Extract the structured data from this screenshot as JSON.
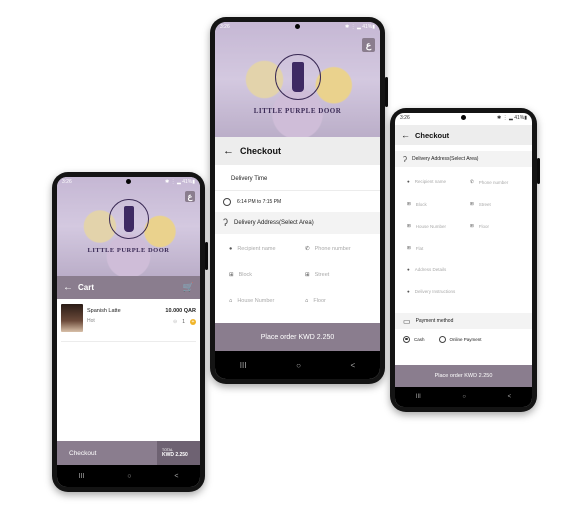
{
  "brand": {
    "logo_text": "LITTLE PURPLE DOOR",
    "accent": "#8a7d8e",
    "lang_button": "ع"
  },
  "cart_phone": {
    "status": {
      "time": "3:26",
      "right": "✱ ⋮ ▂ 41%▮"
    },
    "title": "Cart",
    "item": {
      "name": "Spanish Latte",
      "option": "Hot",
      "price": "10.000 QAR",
      "quantity": "1"
    },
    "footer": {
      "checkout_label": "Checkout",
      "total_label": "TOTAL",
      "total_value": "KWD 2.250"
    }
  },
  "checkout_phone": {
    "status": {
      "time": "3:26",
      "right": "✱ ⋮ ▂ 41%▮"
    },
    "title": "Checkout",
    "delivery_time_label": "Delivery Time",
    "delivery_time_value": "6:14 PM to 7:15 PM",
    "address_label": "Delivery Address(Select Area)",
    "fields": {
      "recipient": "Recipient name",
      "phone": "Phone number",
      "block": "Block",
      "street": "Street",
      "house": "House Number",
      "floor": "Floor"
    },
    "place_order": "Place order  KWD 2.250"
  },
  "address_phone": {
    "status": {
      "time": "3:26",
      "right": "✱ ⋮ ▂ 41%▮"
    },
    "title": "Checkout",
    "address_label": "Delivery Address(Select Area)",
    "fields": {
      "recipient": "Recipient name",
      "phone": "Phone number",
      "block": "Block",
      "street": "Street",
      "house": "House Number",
      "floor": "Floor",
      "flat": "Flat",
      "address_details": "Address Details",
      "instructions": "Delivery Instructions"
    },
    "payment_label": "Payment method",
    "payment_options": {
      "cash": "Cash",
      "online": "Online Payment"
    },
    "place_order": "Place order  KWD 2.250"
  },
  "nav": {
    "recent": "III",
    "home": "○",
    "back": "<"
  }
}
